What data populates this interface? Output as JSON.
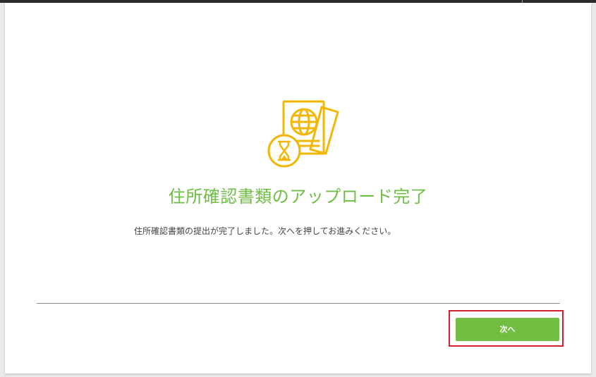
{
  "dialog": {
    "title": "住所確認書類のアップロード完了",
    "message": "住所確認書類の提出が完了しました。次へを押してお進みください。",
    "next_button_label": "次へ",
    "illustration_icon": "passport-document-hourglass-icon"
  },
  "colors": {
    "accent_green": "#72be43",
    "title_green": "#6fbe44",
    "icon_yellow": "#f2b705",
    "highlight_red": "#d3202e"
  }
}
